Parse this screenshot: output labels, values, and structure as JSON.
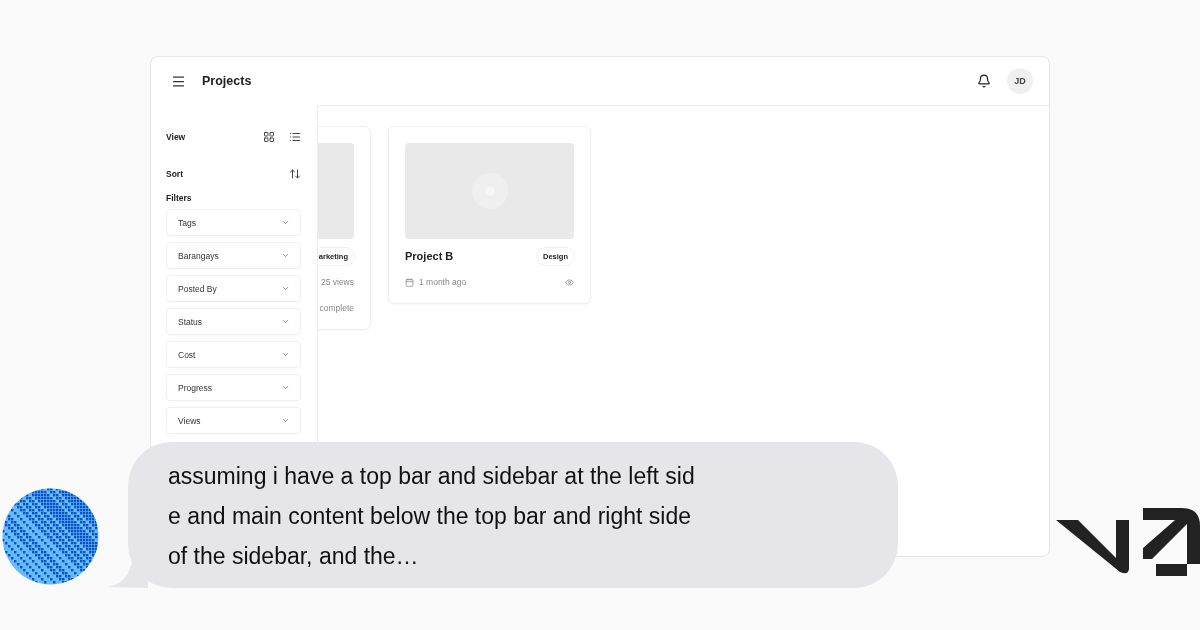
{
  "header": {
    "title": "Projects",
    "avatar_initials": "JD"
  },
  "sidebar": {
    "view_label": "View",
    "sort_label": "Sort",
    "filters_label": "Filters",
    "filters": [
      "Tags",
      "Barangays",
      "Posted By",
      "Status",
      "Cost",
      "Progress",
      "Views"
    ]
  },
  "projects": [
    {
      "tag": "arketing",
      "views": "25 views",
      "progress": "complete"
    },
    {
      "title": "Project B",
      "tag": "Design",
      "date": "1 month ago"
    }
  ],
  "message": {
    "lines": [
      "assuming i have a top bar and sidebar at the left sid",
      "e and main content below the top bar and right side",
      "of the sidebar, and the…"
    ]
  }
}
